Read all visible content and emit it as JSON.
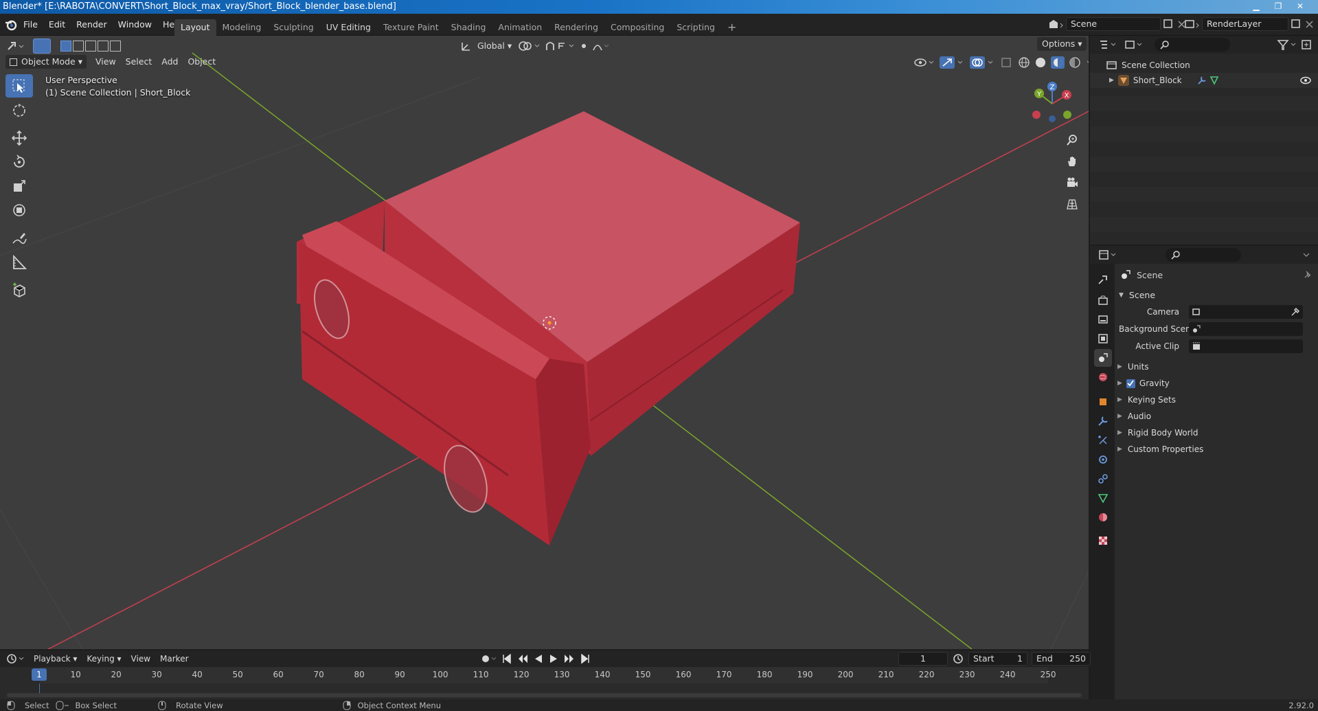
{
  "window": {
    "title": "Blender* [E:\\RABOTA\\CONVERT\\Short_Block_max_vray/Short_Block_blender_base.blend]",
    "minimize": "▁",
    "maximize": "❐",
    "close": "✕"
  },
  "menubar": {
    "menus": [
      "File",
      "Edit",
      "Render",
      "Window",
      "Help"
    ],
    "workspaces": [
      "Layout",
      "Modeling",
      "Sculpting",
      "UV Editing",
      "Texture Paint",
      "Shading",
      "Animation",
      "Rendering",
      "Compositing",
      "Scripting"
    ],
    "active_workspace": "Layout",
    "add_workspace": "+",
    "scene_name": "Scene",
    "render_layer": "RenderLayer"
  },
  "viewport": {
    "mode": "Object Mode",
    "menus": [
      "View",
      "Select",
      "Add",
      "Object"
    ],
    "transform_orientation": "Global",
    "options_label": "Options",
    "overlay_line1": "User Perspective",
    "overlay_line2": "(1) Scene Collection | Short_Block",
    "gizmo": {
      "x": "X",
      "y": "Y",
      "z": "Z"
    },
    "tools": [
      "select-box",
      "cursor",
      "move",
      "rotate",
      "scale",
      "transform",
      "annotate",
      "measure",
      "add-cube"
    ]
  },
  "outliner": {
    "collection": "Scene Collection",
    "object": "Short_Block"
  },
  "properties": {
    "context": "Scene",
    "panel_title": "Scene",
    "camera_label": "Camera",
    "background_scene_label": "Background Scene",
    "active_clip_label": "Active Clip",
    "subpanels": [
      "Units",
      "Gravity",
      "Keying Sets",
      "Audio",
      "Rigid Body World",
      "Custom Properties"
    ],
    "gravity_checked": true
  },
  "timeline": {
    "menus": [
      "Playback",
      "Keying",
      "View",
      "Marker"
    ],
    "current_frame": "1",
    "start_label": "Start",
    "start_value": "1",
    "end_label": "End",
    "end_value": "250",
    "ticks": [
      "1",
      "10",
      "20",
      "30",
      "40",
      "50",
      "60",
      "70",
      "80",
      "90",
      "100",
      "110",
      "120",
      "130",
      "140",
      "150",
      "160",
      "170",
      "180",
      "190",
      "200",
      "210",
      "220",
      "230",
      "240",
      "250"
    ]
  },
  "statusbar": {
    "select": "Select",
    "box_select": "Box Select",
    "rotate_view": "Rotate View",
    "context_menu": "Object Context Menu",
    "version": "2.92.0"
  },
  "colors": {
    "accent": "#4772b3",
    "viewport_bg": "#3d3d3d",
    "object_red": "#c4303e",
    "x_axis": "#c8404e",
    "y_axis": "#7aa52a"
  }
}
